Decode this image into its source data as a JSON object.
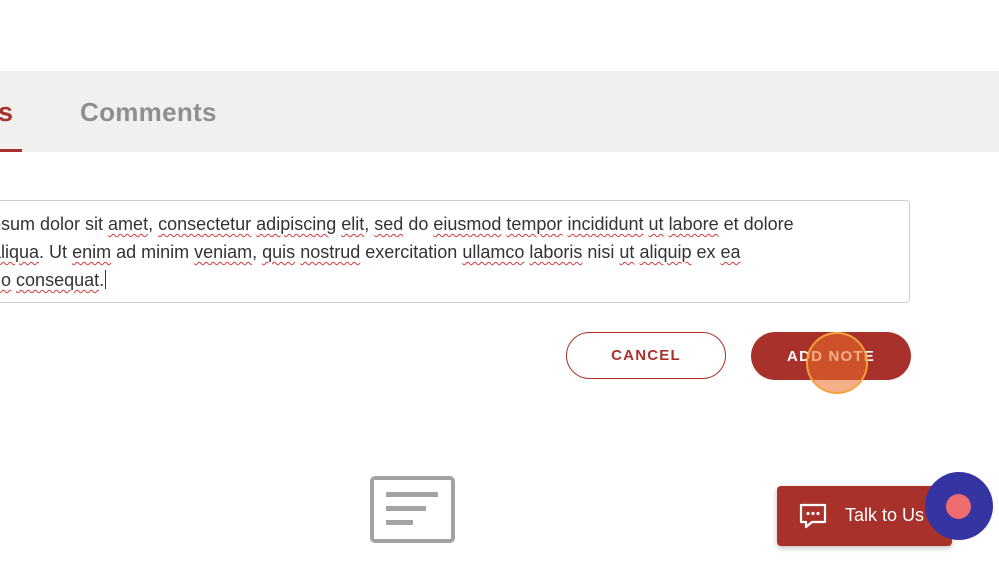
{
  "tabs": {
    "active_label": "s",
    "comments_label": "Comments"
  },
  "note": {
    "line1": [
      "osum dolor sit ",
      "amet",
      ", ",
      "consectetur",
      " ",
      "adipiscing",
      " ",
      "elit",
      ", ",
      "sed",
      " do ",
      "eiusmod",
      " ",
      "tempor",
      " ",
      "incididunt",
      " ",
      "ut",
      " ",
      "labore",
      " et dolore"
    ],
    "line2": [
      "aliqua",
      ". Ut ",
      "enim",
      " ad minim ",
      "veniam",
      ", ",
      "quis",
      " ",
      "nostrud",
      " exercitation ",
      "ullamco",
      " ",
      "laboris",
      " nisi ",
      "ut",
      " ",
      "aliquip",
      " ex ",
      "ea"
    ],
    "line3": [
      "do",
      " ",
      "consequat",
      "."
    ]
  },
  "buttons": {
    "cancel": "CANCEL",
    "add_note": "ADD NOTE"
  },
  "chat": {
    "talk_label": "Talk to Us"
  },
  "colors": {
    "accent": "#a8322b",
    "chat_bubble": "#3434a3",
    "bubble_dot": "#ee6b6e",
    "tabbar_bg": "#f1f0ee"
  },
  "icons": {
    "empty_state": "notes-document-icon",
    "chat": "chat-message-icon"
  }
}
